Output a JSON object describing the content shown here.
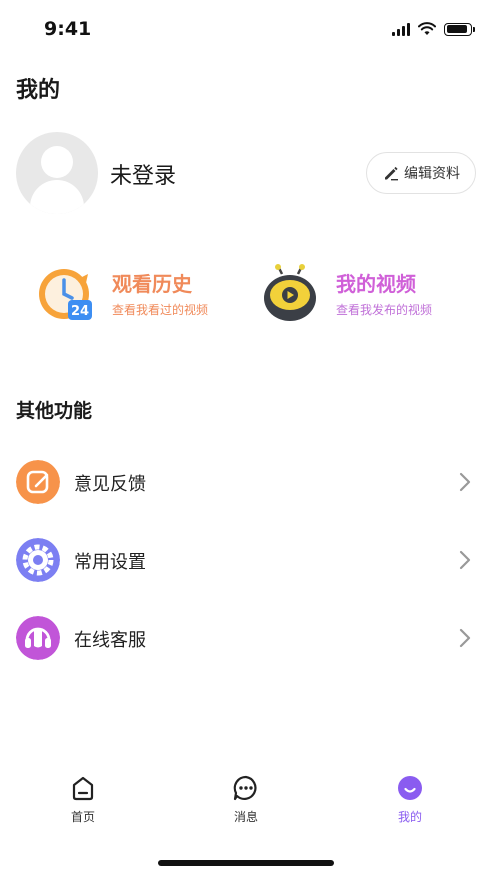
{
  "status_bar": {
    "time": "9:41",
    "battery_level": 0.9
  },
  "page_title": "我的",
  "profile": {
    "username": "未登录",
    "edit_label": "编辑资料"
  },
  "quick_actions": [
    {
      "title": "观看历史",
      "subtitle": "查看我看过的视频",
      "icon": "clock-history-icon",
      "badge": "24"
    },
    {
      "title": "我的视频",
      "subtitle": "查看我发布的视频",
      "icon": "tv-video-icon"
    }
  ],
  "section_title": "其他功能",
  "menu": [
    {
      "label": "意见反馈",
      "icon": "feedback-edit-icon",
      "color": "#f7934a"
    },
    {
      "label": "常用设置",
      "icon": "settings-gear-icon",
      "color": "#7c7ff2"
    },
    {
      "label": "在线客服",
      "icon": "headset-service-icon",
      "color": "#c155d8"
    }
  ],
  "tabbar": [
    {
      "label": "首页",
      "icon": "home-icon",
      "active": false
    },
    {
      "label": "消息",
      "icon": "message-icon",
      "active": false
    },
    {
      "label": "我的",
      "icon": "profile-icon",
      "active": true,
      "accent": "#8a5cf0"
    }
  ]
}
